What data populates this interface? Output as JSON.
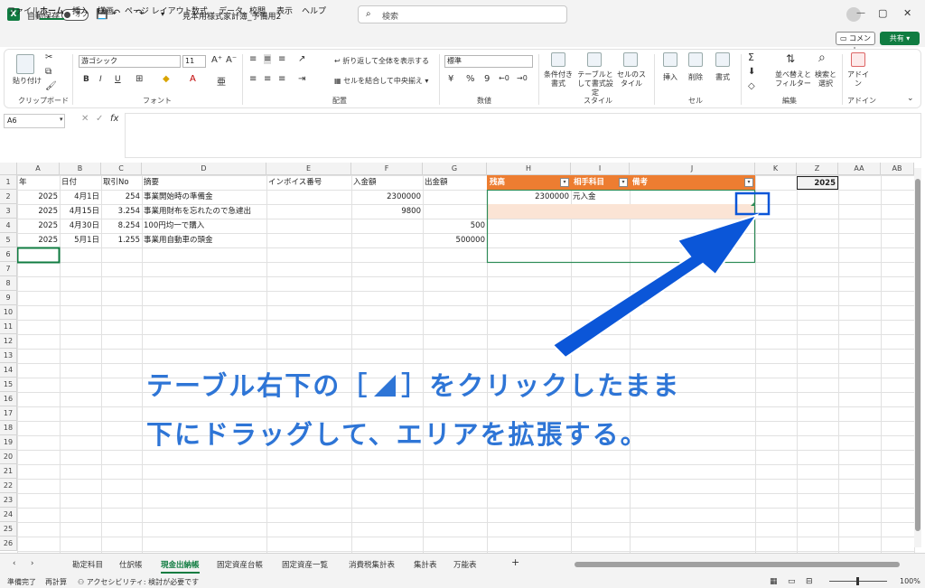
{
  "titlebar": {
    "app_letter": "X",
    "autosave_label": "自動保存",
    "autosave_state": "オフ",
    "doc_title": "見本用様式家計簿_予備用2",
    "search_placeholder": "検索",
    "min": "—",
    "max": "▢",
    "close": "✕"
  },
  "menus": [
    "ファイル",
    "ホーム",
    "挿入",
    "描画",
    "ページ レイアウト",
    "数式",
    "データ",
    "校閲",
    "表示",
    "ヘルプ"
  ],
  "active_menu": "ホーム",
  "comment_label": "コメント",
  "share_label": "共有",
  "ribbon": {
    "paste": "貼り付け",
    "clipboard": "クリップボード",
    "font_name": "游ゴシック",
    "font_size": "11",
    "font_group": "フォント",
    "wrap": "折り返して全体を表示する",
    "merge": "セルを結合して中央揃え",
    "align_group": "配置",
    "number_format": "標準",
    "number_group": "数値",
    "cond_format": "条件付き書式",
    "table_format": "テーブルとして書式設定",
    "cell_style": "セルのスタイル",
    "style_group": "スタイル",
    "insert": "挿入",
    "delete": "削除",
    "format": "書式",
    "cell_group": "セル",
    "sort_filter": "並べ替えとフィルター",
    "find_select": "検索と選択",
    "edit_group": "編集",
    "addin": "アドイン",
    "addin_group": "アドイン"
  },
  "formula_bar": {
    "namebox": "A6",
    "fx": "fx"
  },
  "columns": [
    {
      "id": "A"
    },
    {
      "id": "B"
    },
    {
      "id": "C"
    },
    {
      "id": "D"
    },
    {
      "id": "E"
    },
    {
      "id": "F"
    },
    {
      "id": "G"
    },
    {
      "id": "H"
    },
    {
      "id": "I"
    },
    {
      "id": "J"
    },
    {
      "id": "K"
    },
    {
      "id": "Z"
    },
    {
      "id": "AA"
    },
    {
      "id": "AB"
    }
  ],
  "row_numbers": [
    "1",
    "2",
    "3",
    "4",
    "5",
    "6",
    "7",
    "8",
    "9",
    "10",
    "11",
    "12",
    "13",
    "14",
    "15",
    "16",
    "17",
    "18",
    "19",
    "20",
    "21",
    "22",
    "23",
    "24",
    "25",
    "26"
  ],
  "header_row": [
    "年",
    "日付",
    "取引No",
    "摘要",
    "インボイス番号",
    "入金額",
    "出金額"
  ],
  "table_headers": [
    "残高",
    "相手科目",
    "備考"
  ],
  "z1": "2025",
  "rows": [
    {
      "year": "2025",
      "date": "4月1日",
      "no": "254",
      "desc": "事業開始時の準備金",
      "in": "2300000",
      "out": "",
      "bal": "2300000",
      "acct": "元入金"
    },
    {
      "year": "2025",
      "date": "4月15日",
      "no": "3.254",
      "desc": "事業用財布を忘れたので急遽出",
      "in": "9800",
      "out": "",
      "bal": "",
      "acct": ""
    },
    {
      "year": "2025",
      "date": "4月30日",
      "no": "8.254",
      "desc": "100円均一で購入",
      "in": "",
      "out": "500",
      "bal": "",
      "acct": ""
    },
    {
      "year": "2025",
      "date": "5月1日",
      "no": "1.255",
      "desc": "事業用自動車の頭金",
      "in": "",
      "out": "500000",
      "bal": "",
      "acct": ""
    }
  ],
  "annotation": {
    "line1a": "テーブル右下の［",
    "line1b": "］をクリックしたまま",
    "line2": "下にドラッグして、エリアを拡張する。"
  },
  "sheet_tabs": [
    "勘定科目",
    "仕訳帳",
    "現金出納帳",
    "固定資産台帳",
    "固定資産一覧",
    "消費税集計表",
    "集計表",
    "万能表"
  ],
  "active_tab": "現金出納帳",
  "add_sheet": "+",
  "status": {
    "ready": "準備完了",
    "recalc": "再計算",
    "accessibility": "アクセシビリティ: 検討が必要です",
    "zoom": "100%"
  },
  "colors": {
    "accent": "#107c41",
    "table_header": "#ed7d31",
    "table_row": "#fbe4d5",
    "annotation": "#2e75d6",
    "arrow": "#0b56d8"
  }
}
